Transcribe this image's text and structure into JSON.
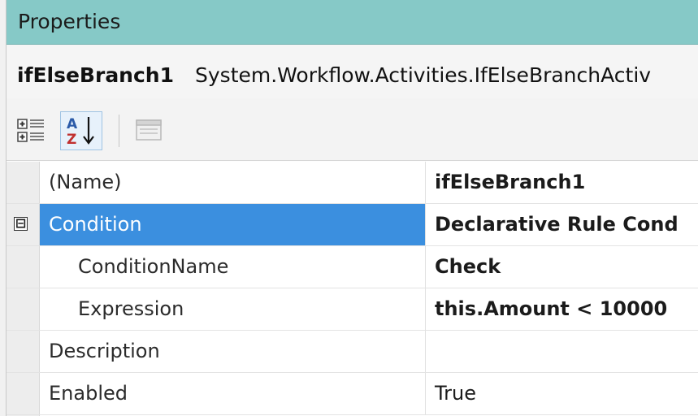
{
  "panel": {
    "title": "Properties"
  },
  "object": {
    "name": "ifElseBranch1",
    "type": "System.Workflow.Activities.IfElseBranchActiv"
  },
  "toolbar": {
    "categorized_icon": "categorized-icon",
    "alphabetical_icon": "alphabetical-sort-icon",
    "property_pages_icon": "property-pages-icon"
  },
  "properties": [
    {
      "name": "(Name)",
      "value": "ifElseBranch1"
    },
    {
      "name": "Condition",
      "value": "Declarative Rule Cond",
      "expander": "⊟"
    },
    {
      "name": "ConditionName",
      "value": "Check"
    },
    {
      "name": "Expression",
      "value": "this.Amount < 10000"
    },
    {
      "name": "Description",
      "value": ""
    },
    {
      "name": "Enabled",
      "value": "True"
    }
  ],
  "colors": {
    "title_bar": "#86c9c7",
    "selection": "#3b8fdf"
  }
}
